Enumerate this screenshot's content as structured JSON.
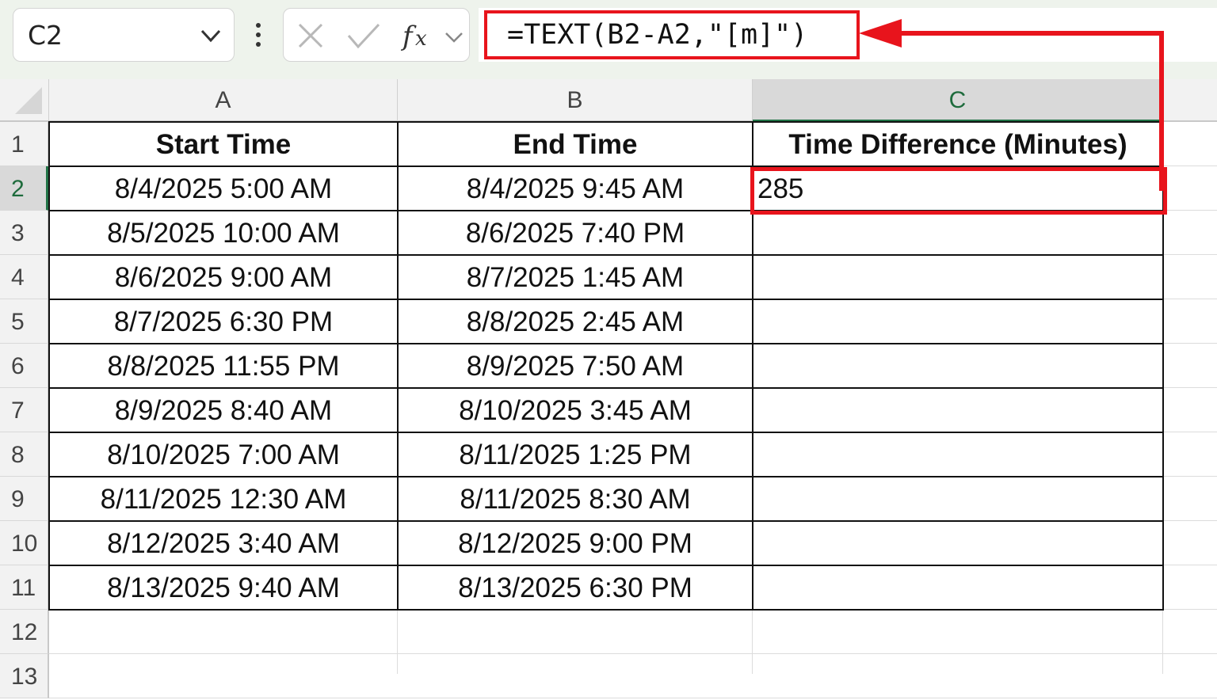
{
  "name_box": {
    "value": "C2"
  },
  "formula_bar": {
    "formula": "=TEXT(B2-A2,\"[m]\")"
  },
  "columns": [
    "A",
    "B",
    "C"
  ],
  "selected_column": "C",
  "rows": [
    "1",
    "2",
    "3",
    "4",
    "5",
    "6",
    "7",
    "8",
    "9",
    "10",
    "11",
    "12",
    "13"
  ],
  "selected_row": "2",
  "table": {
    "headers": [
      "Start Time",
      "End Time",
      "Time Difference (Minutes)"
    ],
    "data": [
      [
        "8/4/2025 5:00 AM",
        "8/4/2025 9:45 AM",
        "285"
      ],
      [
        "8/5/2025 10:00 AM",
        "8/6/2025 7:40 PM",
        ""
      ],
      [
        "8/6/2025 9:00 AM",
        "8/7/2025 1:45 AM",
        ""
      ],
      [
        "8/7/2025 6:30 PM",
        "8/8/2025 2:45 AM",
        ""
      ],
      [
        "8/8/2025 11:55 PM",
        "8/9/2025 7:50 AM",
        ""
      ],
      [
        "8/9/2025 8:40 AM",
        "8/10/2025 3:45 AM",
        ""
      ],
      [
        "8/10/2025 7:00 AM",
        "8/11/2025 1:25 PM",
        ""
      ],
      [
        "8/11/2025 12:30 AM",
        "8/11/2025 8:30 AM",
        ""
      ],
      [
        "8/12/2025 3:40 AM",
        "8/12/2025 9:00 PM",
        ""
      ],
      [
        "8/13/2025 9:40 AM",
        "8/13/2025 6:30 PM",
        ""
      ]
    ]
  },
  "icons": {
    "name_box_dropdown": "chevron-down-icon",
    "more": "vertical-dots-icon",
    "cancel": "x-icon",
    "enter": "checkmark-icon",
    "insert_function": "fx-icon",
    "fx_dropdown": "chevron-down-icon",
    "select_all": "select-all-triangle-icon"
  },
  "colors": {
    "highlight": "#e8141c",
    "selection": "#217346",
    "topbar_bg": "#eef3ec"
  }
}
